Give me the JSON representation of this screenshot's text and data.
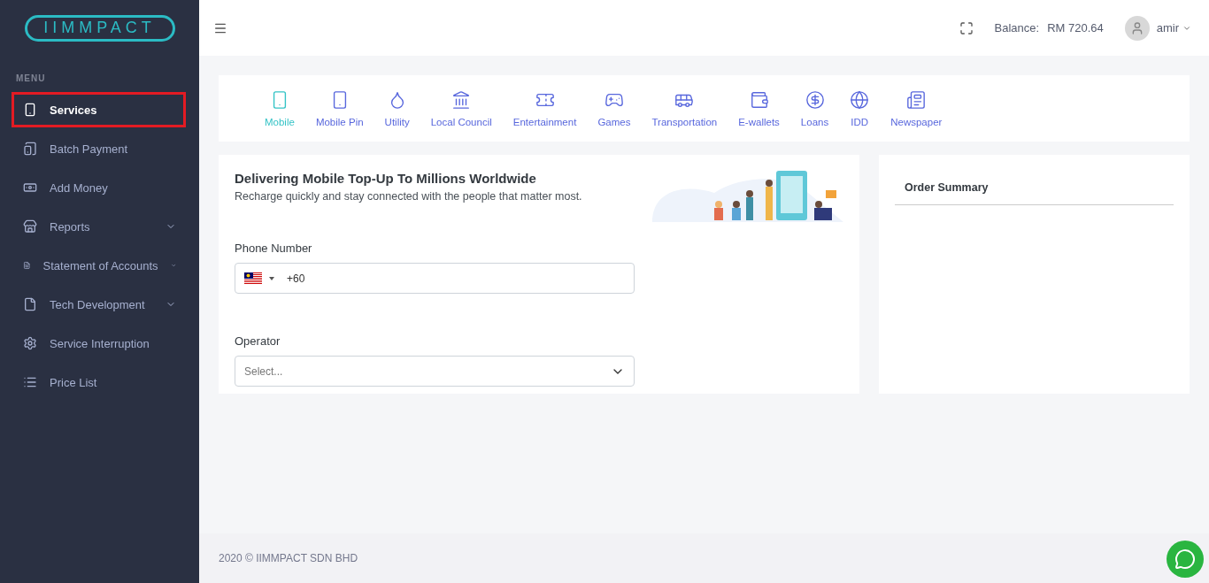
{
  "logo": {
    "text": "IIMMPACT"
  },
  "sidebar": {
    "heading": "MENU",
    "items": [
      {
        "label": "Services",
        "selected": true,
        "expandable": false
      },
      {
        "label": "Batch Payment",
        "selected": false,
        "expandable": false
      },
      {
        "label": "Add Money",
        "selected": false,
        "expandable": false
      },
      {
        "label": "Reports",
        "selected": false,
        "expandable": true
      },
      {
        "label": "Statement of Accounts",
        "selected": false,
        "expandable": true
      },
      {
        "label": "Tech Development",
        "selected": false,
        "expandable": true
      },
      {
        "label": "Service Interruption",
        "selected": false,
        "expandable": false
      },
      {
        "label": "Price List",
        "selected": false,
        "expandable": false
      }
    ]
  },
  "header": {
    "balance_label": "Balance:",
    "balance_value": "RM 720.64",
    "user": "amir"
  },
  "services": [
    {
      "label": "Mobile",
      "selected": true
    },
    {
      "label": "Mobile Pin",
      "selected": false
    },
    {
      "label": "Utility",
      "selected": false
    },
    {
      "label": "Local Council",
      "selected": false
    },
    {
      "label": "Entertainment",
      "selected": false
    },
    {
      "label": "Games",
      "selected": false
    },
    {
      "label": "Transportation",
      "selected": false
    },
    {
      "label": "E-wallets",
      "selected": false
    },
    {
      "label": "Loans",
      "selected": false
    },
    {
      "label": "IDD",
      "selected": false
    },
    {
      "label": "Newspaper",
      "selected": false
    }
  ],
  "form": {
    "title": "Delivering Mobile Top-Up To Millions Worldwide",
    "subtitle": "Recharge quickly and stay connected with the people that matter most.",
    "phone_label": "Phone Number",
    "phone_value": "+60",
    "operator_label": "Operator",
    "operator_placeholder": "Select..."
  },
  "order_summary": {
    "title": "Order Summary"
  },
  "footer": {
    "text": "2020 © IIMMPACT SDN BHD"
  }
}
